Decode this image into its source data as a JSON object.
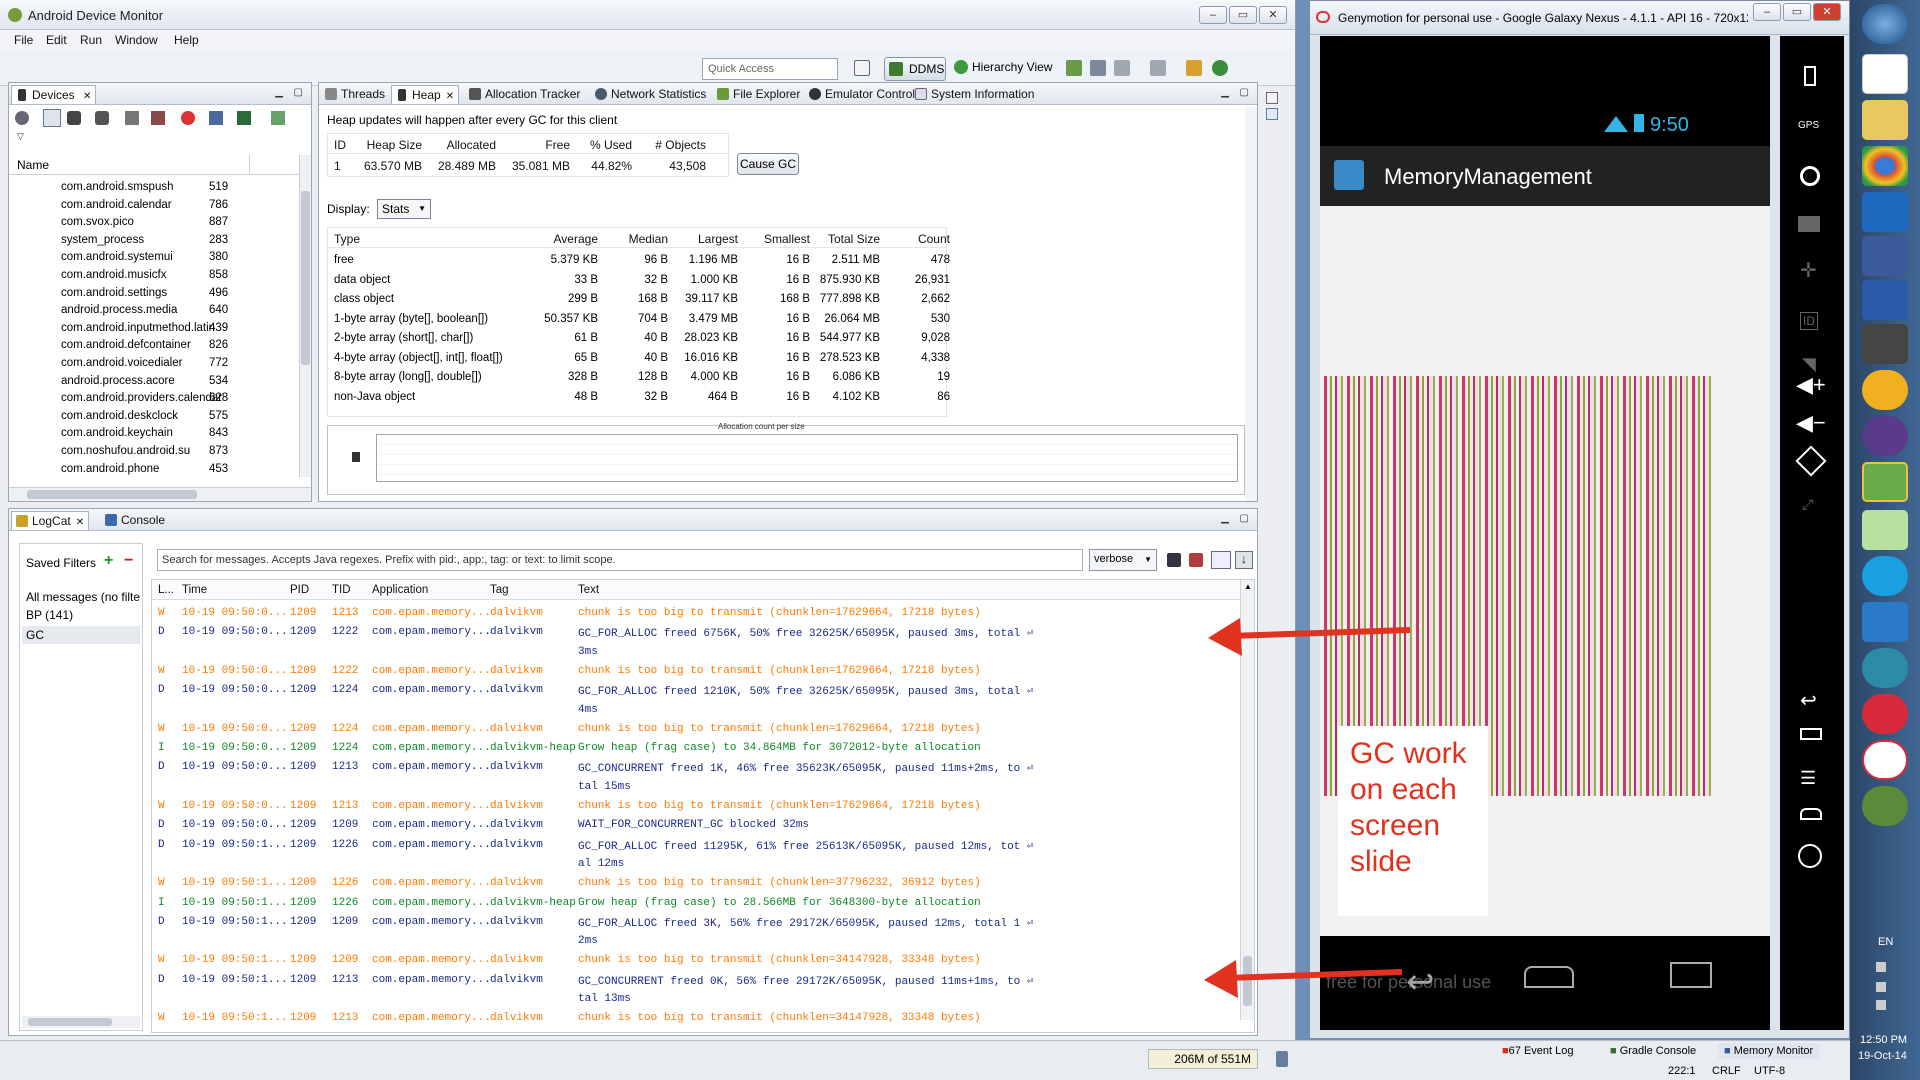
{
  "adm": {
    "title": "Android Device Monitor",
    "menu": [
      "File",
      "Edit",
      "Run",
      "Window",
      "Help"
    ],
    "quick_access_placeholder": "Quick Access",
    "ddms_label": "DDMS",
    "hierarchy_view_label": "Hierarchy View"
  },
  "devices": {
    "tab_label": "Devices",
    "column_name": "Name",
    "processes": [
      {
        "name": "com.android.smspush",
        "pid": "519"
      },
      {
        "name": "com.android.calendar",
        "pid": "786"
      },
      {
        "name": "com.svox.pico",
        "pid": "887"
      },
      {
        "name": "system_process",
        "pid": "283"
      },
      {
        "name": "com.android.systemui",
        "pid": "380"
      },
      {
        "name": "com.android.musicfx",
        "pid": "858"
      },
      {
        "name": "com.android.settings",
        "pid": "496"
      },
      {
        "name": "android.process.media",
        "pid": "640"
      },
      {
        "name": "com.android.inputmethod.latin",
        "pid": "439"
      },
      {
        "name": "com.android.defcontainer",
        "pid": "826"
      },
      {
        "name": "com.android.voicedialer",
        "pid": "772"
      },
      {
        "name": "android.process.acore",
        "pid": "534"
      },
      {
        "name": "com.android.providers.calendar",
        "pid": "628"
      },
      {
        "name": "com.android.deskclock",
        "pid": "575"
      },
      {
        "name": "com.android.keychain",
        "pid": "843"
      },
      {
        "name": "com.noshufou.android.su",
        "pid": "873"
      },
      {
        "name": "com.android.phone",
        "pid": "453"
      }
    ]
  },
  "heap_tabs": [
    "Threads",
    "Heap",
    "Allocation Tracker",
    "Network Statistics",
    "File Explorer",
    "Emulator Control",
    "System Information"
  ],
  "heap": {
    "notice": "Heap updates will happen after every GC for this client",
    "summary_headers": [
      "ID",
      "Heap Size",
      "Allocated",
      "Free",
      "% Used",
      "# Objects"
    ],
    "summary_values": [
      "1",
      "63.570 MB",
      "28.489 MB",
      "35.081 MB",
      "44.82%",
      "43,508"
    ],
    "cause_gc_label": "Cause GC",
    "display_label": "Display:",
    "display_value": "Stats",
    "type_headers": [
      "Type",
      "Count",
      "Total Size",
      "Smallest",
      "Largest",
      "Median",
      "Average"
    ],
    "type_rows": [
      [
        "free",
        "478",
        "2.511 MB",
        "16 B",
        "1.196 MB",
        "96 B",
        "5.379 KB"
      ],
      [
        "data object",
        "26,931",
        "875.930 KB",
        "16 B",
        "1.000 KB",
        "32 B",
        "33 B"
      ],
      [
        "class object",
        "2,662",
        "777.898 KB",
        "168 B",
        "39.117 KB",
        "168 B",
        "299 B"
      ],
      [
        "1-byte array (byte[], boolean[])",
        "530",
        "26.064 MB",
        "16 B",
        "3.479 MB",
        "704 B",
        "50.357 KB"
      ],
      [
        "2-byte array (short[], char[])",
        "9,028",
        "544.977 KB",
        "16 B",
        "28.023 KB",
        "40 B",
        "61 B"
      ],
      [
        "4-byte array (object[], int[], float[])",
        "4,338",
        "278.523 KB",
        "16 B",
        "16.016 KB",
        "40 B",
        "65 B"
      ],
      [
        "8-byte array (long[], double[])",
        "19",
        "6.086 KB",
        "16 B",
        "4.000 KB",
        "128 B",
        "328 B"
      ],
      [
        "non-Java object",
        "86",
        "4.102 KB",
        "16 B",
        "464 B",
        "32 B",
        "48 B"
      ]
    ],
    "chart_title": "Allocation count per size"
  },
  "logcat": {
    "tab_label": "LogCat",
    "console_label": "Console",
    "saved_filters_label": "Saved Filters",
    "filters": [
      "All messages (no filte",
      "BP (141)",
      "GC"
    ],
    "search_placeholder": "Search for messages. Accepts Java regexes. Prefix with pid:, app:, tag: or text: to limit scope.",
    "level_value": "verbose",
    "headers": [
      "L...",
      "Time",
      "PID",
      "TID",
      "Application",
      "Tag",
      "Text"
    ],
    "rows": [
      {
        "l": "W",
        "time": "10-19 09:50:0...",
        "pid": "1209",
        "tid": "1213",
        "app": "com.epam.memory...",
        "tag": "dalvikvm",
        "text": "chunk is too big to transmit (chunklen=17629664, 17218 bytes)"
      },
      {
        "l": "D",
        "time": "10-19 09:50:0...",
        "pid": "1209",
        "tid": "1222",
        "app": "com.epam.memory...",
        "tag": "dalvikvm",
        "text": "GC_FOR_ALLOC freed 6756K, 50% free 32625K/65095K, paused 3ms, total ⏎"
      },
      {
        "l": "",
        "time": "",
        "pid": "",
        "tid": "",
        "app": "",
        "tag": "",
        "text": " 3ms"
      },
      {
        "l": "W",
        "time": "10-19 09:50:0...",
        "pid": "1209",
        "tid": "1222",
        "app": "com.epam.memory...",
        "tag": "dalvikvm",
        "text": "chunk is too big to transmit (chunklen=17629664, 17218 bytes)"
      },
      {
        "l": "D",
        "time": "10-19 09:50:0...",
        "pid": "1209",
        "tid": "1224",
        "app": "com.epam.memory...",
        "tag": "dalvikvm",
        "text": "GC_FOR_ALLOC freed 1210K, 50% free 32625K/65095K, paused 3ms, total ⏎"
      },
      {
        "l": "",
        "time": "",
        "pid": "",
        "tid": "",
        "app": "",
        "tag": "",
        "text": " 4ms"
      },
      {
        "l": "W",
        "time": "10-19 09:50:0...",
        "pid": "1209",
        "tid": "1224",
        "app": "com.epam.memory...",
        "tag": "dalvikvm",
        "text": "chunk is too big to transmit (chunklen=17629664, 17218 bytes)"
      },
      {
        "l": "I",
        "time": "10-19 09:50:0...",
        "pid": "1209",
        "tid": "1224",
        "app": "com.epam.memory...",
        "tag": "dalvikvm-heap",
        "text": "Grow heap (frag case) to 34.864MB for 3072012-byte allocation"
      },
      {
        "l": "D",
        "time": "10-19 09:50:0...",
        "pid": "1209",
        "tid": "1213",
        "app": "com.epam.memory...",
        "tag": "dalvikvm",
        "text": "GC_CONCURRENT freed 1K, 46% free 35623K/65095K, paused 11ms+2ms, to ⏎"
      },
      {
        "l": "",
        "time": "",
        "pid": "",
        "tid": "",
        "app": "",
        "tag": "",
        "text": "tal 15ms"
      },
      {
        "l": "W",
        "time": "10-19 09:50:0...",
        "pid": "1209",
        "tid": "1213",
        "app": "com.epam.memory...",
        "tag": "dalvikvm",
        "text": "chunk is too big to transmit (chunklen=17629664, 17218 bytes)"
      },
      {
        "l": "D",
        "time": "10-19 09:50:0...",
        "pid": "1209",
        "tid": "1209",
        "app": "com.epam.memory...",
        "tag": "dalvikvm",
        "text": "WAIT_FOR_CONCURRENT_GC blocked 32ms"
      },
      {
        "l": "D",
        "time": "10-19 09:50:1...",
        "pid": "1209",
        "tid": "1226",
        "app": "com.epam.memory...",
        "tag": "dalvikvm",
        "text": "GC_FOR_ALLOC freed 11295K, 61% free 25613K/65095K, paused 12ms, tot ⏎"
      },
      {
        "l": "",
        "time": "",
        "pid": "",
        "tid": "",
        "app": "",
        "tag": "",
        "text": "al 12ms"
      },
      {
        "l": "W",
        "time": "10-19 09:50:1...",
        "pid": "1209",
        "tid": "1226",
        "app": "com.epam.memory...",
        "tag": "dalvikvm",
        "text": "chunk is too big to transmit (chunklen=37796232, 36912 bytes)"
      },
      {
        "l": "I",
        "time": "10-19 09:50:1...",
        "pid": "1209",
        "tid": "1226",
        "app": "com.epam.memory...",
        "tag": "dalvikvm-heap",
        "text": "Grow heap (frag case) to 28.566MB for 3648300-byte allocation"
      },
      {
        "l": "D",
        "time": "10-19 09:50:1...",
        "pid": "1209",
        "tid": "1209",
        "app": "com.epam.memory...",
        "tag": "dalvikvm",
        "text": "GC_FOR_ALLOC freed 3K, 56% free 29172K/65095K, paused 12ms, total 1 ⏎"
      },
      {
        "l": "",
        "time": "",
        "pid": "",
        "tid": "",
        "app": "",
        "tag": "",
        "text": "2ms"
      },
      {
        "l": "W",
        "time": "10-19 09:50:1...",
        "pid": "1209",
        "tid": "1209",
        "app": "com.epam.memory...",
        "tag": "dalvikvm",
        "text": "chunk is too big to transmit (chunklen=34147928, 33348 bytes)"
      },
      {
        "l": "D",
        "time": "10-19 09:50:1...",
        "pid": "1209",
        "tid": "1213",
        "app": "com.epam.memory...",
        "tag": "dalvikvm",
        "text": "GC_CONCURRENT freed 0K, 56% free 29172K/65095K, paused 11ms+1ms, to ⏎"
      },
      {
        "l": "",
        "time": "",
        "pid": "",
        "tid": "",
        "app": "",
        "tag": "",
        "text": "tal 13ms"
      },
      {
        "l": "W",
        "time": "10-19 09:50:1...",
        "pid": "1209",
        "tid": "1213",
        "app": "com.epam.memory...",
        "tag": "dalvikvm",
        "text": "chunk is too big to transmit (chunklen=34147928, 33348 bytes)"
      }
    ]
  },
  "status": {
    "memory": "206M of 551M",
    "event_log": "67 Event Log",
    "gradle_console": "Gradle Console",
    "memory_monitor": "Memory Monitor",
    "caret": "222:1",
    "line_sep": "CRLF",
    "encoding": "UTF-8"
  },
  "genymotion": {
    "title": "Genymotion for personal use - Google Galaxy Nexus - 4.1.1 - API 16 - 720x12...",
    "clock": "9:50",
    "app_title": "MemoryManagement",
    "watermark": "free for personal use",
    "annotation": "GC work on each screen slide",
    "sidebar_labels": [
      "GPS",
      "ID"
    ]
  },
  "taskbar": {
    "lang": "EN",
    "time": "12:50 PM",
    "date": "19-Oct-14"
  },
  "colors": {
    "warn": "#ff7a00",
    "debug": "#1a2a88",
    "info": "#10862a",
    "annotation": "#e0321e"
  }
}
